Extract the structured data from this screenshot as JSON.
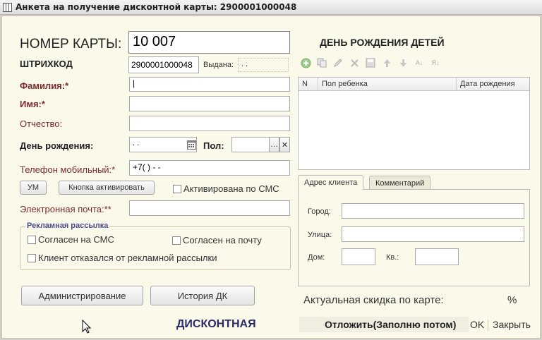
{
  "window": {
    "title": "Анкета на получение дисконтной карты: 2900001000048"
  },
  "card": {
    "number_label": "НОМЕР КАРТЫ:",
    "number_value": "10 007",
    "barcode_label": "ШТРИХКОД",
    "barcode_value": "2900001000048",
    "issued_label": "Выдана:",
    "issued_value": " .  ."
  },
  "fields": {
    "surname_label": "Фамилия:*",
    "surname_value": "|",
    "name_label": "Имя:*",
    "name_value": "",
    "patronymic_label": "Отчество:",
    "patronymic_value": "",
    "birthday_label": "День рождения:",
    "birthday_value": " .  .",
    "gender_label": "Пол:",
    "gender_value": "",
    "phone_label": "Телефон мобильный:*",
    "phone_value": "+7(  )   -  -",
    "email_label": "Электронная почта:**",
    "email_value": ""
  },
  "buttons": {
    "um": "УМ",
    "activate": "Кнопка активировать",
    "admin": "Администрирование",
    "history": "История ДК"
  },
  "checkboxes": {
    "sms_activated": "Активирована по СМС",
    "agree_sms": "Согласен на СМС",
    "agree_mail": "Согласен на почту",
    "refused": "Клиент отказался от рекламной рассылки"
  },
  "mailing_group": {
    "title": "Рекламная рассылка"
  },
  "children": {
    "title": "ДЕНЬ РОЖДЕНИЯ ДЕТЕЙ",
    "columns": [
      "N",
      "Пол ребенка",
      "Дата рождения"
    ]
  },
  "tabs": {
    "address": "Адрес клиента",
    "comment": "Комментарий"
  },
  "address": {
    "city_label": "Город:",
    "city_value": "",
    "street_label": "Улица:",
    "street_value": "",
    "house_label": "Дом:",
    "house_value": "",
    "apt_label": "Кв.:",
    "apt_value": ""
  },
  "discount": {
    "label": "Актуальная скидка по карте:",
    "value": "%",
    "brand": "ДИСКОНТНАЯ"
  },
  "footer": {
    "postpone": "Отложить(Заполню потом)",
    "ok": "OK",
    "close": "Закрыть"
  },
  "colors": {
    "background": "#fbf9ea",
    "required_label": "#7a2a2a",
    "group_title": "#4a4a90"
  }
}
